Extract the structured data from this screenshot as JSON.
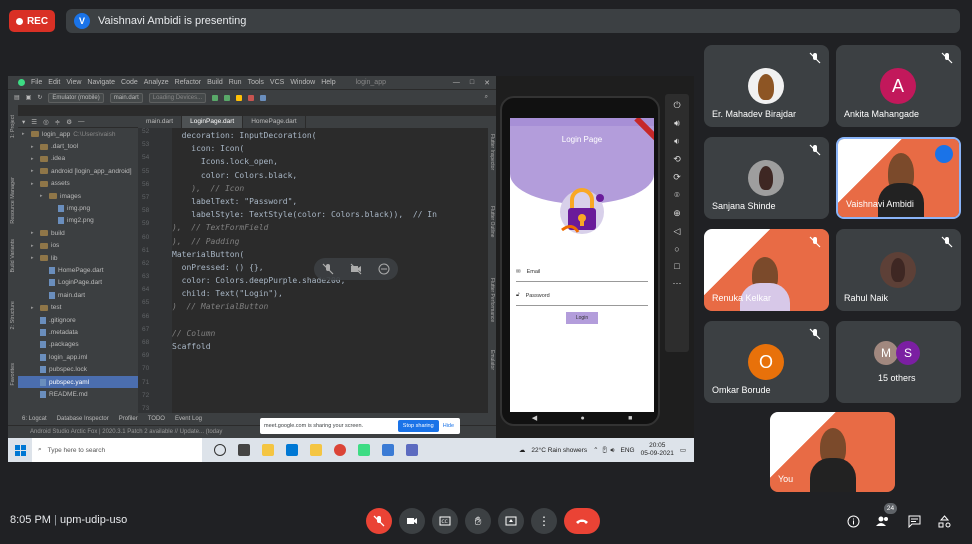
{
  "rec_label": "REC",
  "presenter": {
    "initial": "V",
    "text": "Vaishnavi Ambidi is presenting"
  },
  "android_studio": {
    "menu": [
      "File",
      "Edit",
      "View",
      "Navigate",
      "Code",
      "Analyze",
      "Refactor",
      "Build",
      "Run",
      "Tools",
      "VCS",
      "Window",
      "Help"
    ],
    "project_title": "login_app",
    "device_select": "Emulator (mobile)",
    "run_config": "main.dart",
    "loading": "Loading Devices...",
    "tabs": [
      "main.dart",
      "LoginPage.dart",
      "HomePage.dart"
    ],
    "tree": [
      {
        "label": "login_app",
        "indent": 0,
        "type": "folder",
        "hl": false,
        "suffix": "C:\\Users\\vaish"
      },
      {
        "label": ".dart_tool",
        "indent": 1,
        "type": "folder",
        "hl": false
      },
      {
        "label": ".idea",
        "indent": 1,
        "type": "folder",
        "hl": false
      },
      {
        "label": "android [login_app_android]",
        "indent": 1,
        "type": "folder",
        "hl": false
      },
      {
        "label": "assets",
        "indent": 1,
        "type": "folder",
        "hl": false
      },
      {
        "label": "images",
        "indent": 2,
        "type": "folder",
        "hl": false
      },
      {
        "label": "img.png",
        "indent": 3,
        "type": "file",
        "hl": false
      },
      {
        "label": "img2.png",
        "indent": 3,
        "type": "file",
        "hl": false
      },
      {
        "label": "build",
        "indent": 1,
        "type": "folder",
        "hl": false
      },
      {
        "label": "ios",
        "indent": 1,
        "type": "folder",
        "hl": false
      },
      {
        "label": "lib",
        "indent": 1,
        "type": "folder",
        "hl": false
      },
      {
        "label": "HomePage.dart",
        "indent": 2,
        "type": "file",
        "hl": false
      },
      {
        "label": "LoginPage.dart",
        "indent": 2,
        "type": "file",
        "hl": false
      },
      {
        "label": "main.dart",
        "indent": 2,
        "type": "file",
        "hl": false
      },
      {
        "label": "test",
        "indent": 1,
        "type": "folder",
        "hl": false
      },
      {
        "label": ".gitignore",
        "indent": 1,
        "type": "file",
        "hl": false
      },
      {
        "label": ".metadata",
        "indent": 1,
        "type": "file",
        "hl": false
      },
      {
        "label": ".packages",
        "indent": 1,
        "type": "file",
        "hl": false
      },
      {
        "label": "login_app.iml",
        "indent": 1,
        "type": "file",
        "hl": false
      },
      {
        "label": "pubspec.lock",
        "indent": 1,
        "type": "file",
        "hl": false
      },
      {
        "label": "pubspec.yaml",
        "indent": 1,
        "type": "file",
        "hl": true
      },
      {
        "label": "README.md",
        "indent": 1,
        "type": "file",
        "hl": false
      }
    ],
    "line_numbers": [
      "52",
      "53",
      "54",
      "55",
      "56",
      "57",
      "58",
      "59",
      "60",
      "61",
      "62",
      "63",
      "64",
      "65",
      "66",
      "67",
      "68",
      "69",
      "70",
      "71",
      "72",
      "73"
    ],
    "code_lines": [
      "  decoration: InputDecoration(",
      "    icon: Icon(",
      "      Icons.lock_open,",
      "      color: Colors.black,",
      "    ),  // Icon",
      "    labelText: \"Password\",",
      "    labelStyle: TextStyle(color: Colors.black)),  // In",
      "),  // TextFormField",
      "),  // Padding",
      "MaterialButton(",
      "  onPressed: () {},",
      "  color: Colors.deepPurple.shade200,",
      "  child: Text(\"Login\"),",
      ")  // MaterialButton",
      "",
      "// Column",
      "Scaffold",
      "",
      "",
      "",
      "",
      ""
    ],
    "left_strip": [
      "1: Project",
      "Resource Manager",
      "Build Variants",
      "2: Structure",
      "Favorites"
    ],
    "right_strip": [
      "Flutter Inspector",
      "Flutter Outline",
      "Flutter Performance",
      "Emulator"
    ],
    "bottom_tabs": [
      "6: Logcat",
      "Database Inspector",
      "Profiler",
      "TODO",
      "Event Log"
    ],
    "status": "Android Studio Arctic Fox | 2020.3.1 Patch 2 available // Update... (today"
  },
  "share_popup": {
    "text": "meet.google.com is sharing your screen.",
    "stop": "Stop sharing",
    "hide": "Hide"
  },
  "emulator": {
    "app_title": "Login Page",
    "email_label": "Email",
    "password_label": "Password",
    "login_button": "Login"
  },
  "taskbar": {
    "search_placeholder": "Type here to search",
    "weather": "22°C  Rain showers",
    "lang": "ENG",
    "time": "20:05",
    "date": "05-09-2021"
  },
  "participants": [
    {
      "name": "Er. Mahadev Birajdar",
      "type": "photo"
    },
    {
      "name": "Ankita Mahangade",
      "type": "initial",
      "initial": "A",
      "color": "#c2185b"
    },
    {
      "name": "Sanjana Shinde",
      "type": "photo"
    },
    {
      "name": "Vaishnavi Ambidi",
      "type": "video"
    },
    {
      "name": "Renuka Kelkar",
      "type": "video"
    },
    {
      "name": "Rahul Naik",
      "type": "photo"
    },
    {
      "name": "Omkar Borude",
      "type": "initial",
      "initial": "O",
      "color": "#e8710a"
    },
    {
      "name": "15 others",
      "type": "others",
      "initials": [
        "M",
        "S"
      ]
    }
  ],
  "self_tile": {
    "name": "You"
  },
  "meeting": {
    "time": "8:05 PM",
    "code": "upm-udip-uso",
    "people_count": "24"
  },
  "colors": {
    "accent": "#1a73e8",
    "danger": "#ea4335",
    "surface": "#3c4043",
    "background": "#202124"
  }
}
